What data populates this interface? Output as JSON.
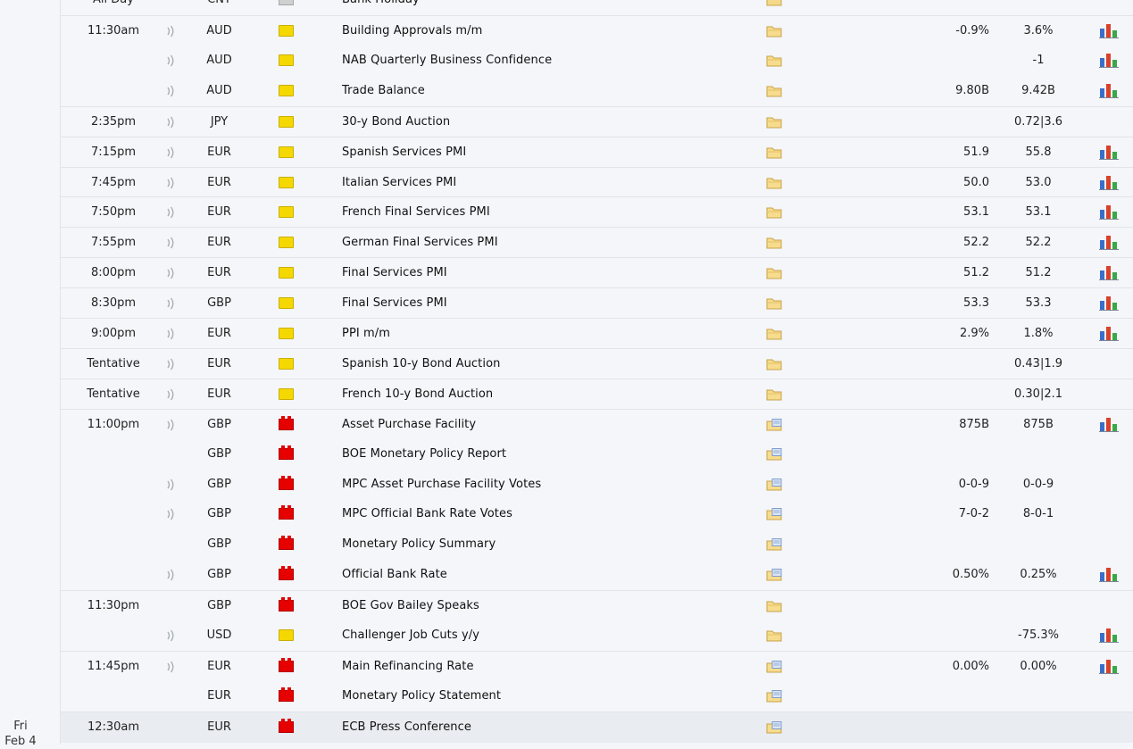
{
  "partial_top": {
    "time": "All Day",
    "currency": "CNY",
    "event": "Bank Holiday"
  },
  "day_label": {
    "weekday": "Fri",
    "date": "Feb 4"
  },
  "rows": [
    {
      "time": "11:30am",
      "sound": true,
      "currency": "AUD",
      "impact": "yellow",
      "event": "Building Approvals m/m",
      "detail": "plain",
      "actual": "",
      "forecast": "-0.9%",
      "previous": "3.6%",
      "chart": true,
      "group_start": true
    },
    {
      "time": "",
      "sound": true,
      "currency": "AUD",
      "impact": "yellow",
      "event": "NAB Quarterly Business Confidence",
      "detail": "plain",
      "actual": "",
      "forecast": "",
      "previous": "-1",
      "chart": true
    },
    {
      "time": "",
      "sound": true,
      "currency": "AUD",
      "impact": "yellow",
      "event": "Trade Balance",
      "detail": "plain",
      "actual": "",
      "forecast": "9.80B",
      "previous": "9.42B",
      "chart": true
    },
    {
      "time": "2:35pm",
      "sound": true,
      "currency": "JPY",
      "impact": "yellow",
      "event": "30-y Bond Auction",
      "detail": "plain",
      "actual": "",
      "forecast": "",
      "previous": "0.72|3.6",
      "chart": false,
      "group_start": true
    },
    {
      "time": "7:15pm",
      "sound": true,
      "currency": "EUR",
      "impact": "yellow",
      "event": "Spanish Services PMI",
      "detail": "plain",
      "actual": "",
      "forecast": "51.9",
      "previous": "55.8",
      "chart": true,
      "group_start": true
    },
    {
      "time": "7:45pm",
      "sound": true,
      "currency": "EUR",
      "impact": "yellow",
      "event": "Italian Services PMI",
      "detail": "plain",
      "actual": "",
      "forecast": "50.0",
      "previous": "53.0",
      "chart": true,
      "group_start": true
    },
    {
      "time": "7:50pm",
      "sound": true,
      "currency": "EUR",
      "impact": "yellow",
      "event": "French Final Services PMI",
      "detail": "plain",
      "actual": "",
      "forecast": "53.1",
      "previous": "53.1",
      "chart": true,
      "group_start": true
    },
    {
      "time": "7:55pm",
      "sound": true,
      "currency": "EUR",
      "impact": "yellow",
      "event": "German Final Services PMI",
      "detail": "plain",
      "actual": "",
      "forecast": "52.2",
      "previous": "52.2",
      "chart": true,
      "group_start": true
    },
    {
      "time": "8:00pm",
      "sound": true,
      "currency": "EUR",
      "impact": "yellow",
      "event": "Final Services PMI",
      "detail": "plain",
      "actual": "",
      "forecast": "51.2",
      "previous": "51.2",
      "chart": true,
      "group_start": true
    },
    {
      "time": "8:30pm",
      "sound": true,
      "currency": "GBP",
      "impact": "yellow",
      "event": "Final Services PMI",
      "detail": "plain",
      "actual": "",
      "forecast": "53.3",
      "previous": "53.3",
      "chart": true,
      "group_start": true
    },
    {
      "time": "9:00pm",
      "sound": true,
      "currency": "EUR",
      "impact": "yellow",
      "event": "PPI m/m",
      "detail": "plain",
      "actual": "",
      "forecast": "2.9%",
      "previous": "1.8%",
      "chart": true,
      "group_start": true
    },
    {
      "time": "Tentative",
      "sound": true,
      "currency": "EUR",
      "impact": "yellow",
      "event": "Spanish 10-y Bond Auction",
      "detail": "plain",
      "actual": "",
      "forecast": "",
      "previous": "0.43|1.9",
      "chart": false,
      "group_start": true
    },
    {
      "time": "Tentative",
      "sound": true,
      "currency": "EUR",
      "impact": "yellow",
      "event": "French 10-y Bond Auction",
      "detail": "plain",
      "actual": "",
      "forecast": "",
      "previous": "0.30|2.1",
      "chart": false,
      "group_start": true
    },
    {
      "time": "11:00pm",
      "sound": true,
      "currency": "GBP",
      "impact": "red",
      "event": "Asset Purchase Facility",
      "detail": "doc",
      "actual": "",
      "forecast": "875B",
      "previous": "875B",
      "chart": true,
      "group_start": true
    },
    {
      "time": "",
      "sound": false,
      "currency": "GBP",
      "impact": "red",
      "event": "BOE Monetary Policy Report",
      "detail": "doc",
      "actual": "",
      "forecast": "",
      "previous": "",
      "chart": false
    },
    {
      "time": "",
      "sound": true,
      "currency": "GBP",
      "impact": "red",
      "event": "MPC Asset Purchase Facility Votes",
      "detail": "doc",
      "actual": "",
      "forecast": "0-0-9",
      "previous": "0-0-9",
      "chart": false
    },
    {
      "time": "",
      "sound": true,
      "currency": "GBP",
      "impact": "red",
      "event": "MPC Official Bank Rate Votes",
      "detail": "doc",
      "actual": "",
      "forecast": "7-0-2",
      "previous": "8-0-1",
      "chart": false
    },
    {
      "time": "",
      "sound": false,
      "currency": "GBP",
      "impact": "red",
      "event": "Monetary Policy Summary",
      "detail": "doc",
      "actual": "",
      "forecast": "",
      "previous": "",
      "chart": false
    },
    {
      "time": "",
      "sound": true,
      "currency": "GBP",
      "impact": "red",
      "event": "Official Bank Rate",
      "detail": "doc",
      "actual": "",
      "forecast": "0.50%",
      "previous": "0.25%",
      "chart": true
    },
    {
      "time": "11:30pm",
      "sound": false,
      "currency": "GBP",
      "impact": "red",
      "event": "BOE Gov Bailey Speaks",
      "detail": "plain",
      "actual": "",
      "forecast": "",
      "previous": "",
      "chart": false,
      "group_start": true
    },
    {
      "time": "",
      "sound": true,
      "currency": "USD",
      "impact": "yellow",
      "event": "Challenger Job Cuts y/y",
      "detail": "plain",
      "actual": "",
      "forecast": "",
      "previous": "-75.3%",
      "chart": true
    },
    {
      "time": "11:45pm",
      "sound": true,
      "currency": "EUR",
      "impact": "red",
      "event": "Main Refinancing Rate",
      "detail": "doc",
      "actual": "",
      "forecast": "0.00%",
      "previous": "0.00%",
      "chart": true,
      "group_start": true
    },
    {
      "time": "",
      "sound": false,
      "currency": "EUR",
      "impact": "red",
      "event": "Monetary Policy Statement",
      "detail": "doc",
      "actual": "",
      "forecast": "",
      "previous": "",
      "chart": false
    },
    {
      "time": "12:30am",
      "sound": false,
      "currency": "EUR",
      "impact": "red",
      "event": "ECB Press Conference",
      "detail": "doc",
      "actual": "",
      "forecast": "",
      "previous": "",
      "chart": false,
      "highlight": true,
      "group_start": true
    }
  ],
  "colors": {
    "impact_yellow": "#f5d800",
    "impact_red": "#e60000",
    "impact_gray": "#cfcfcf",
    "bg": "#f4f6f9",
    "highlight": "#e9ecf0",
    "chart_blue": "#3b6ec9",
    "chart_red": "#d9412a",
    "chart_green": "#38a84a"
  }
}
